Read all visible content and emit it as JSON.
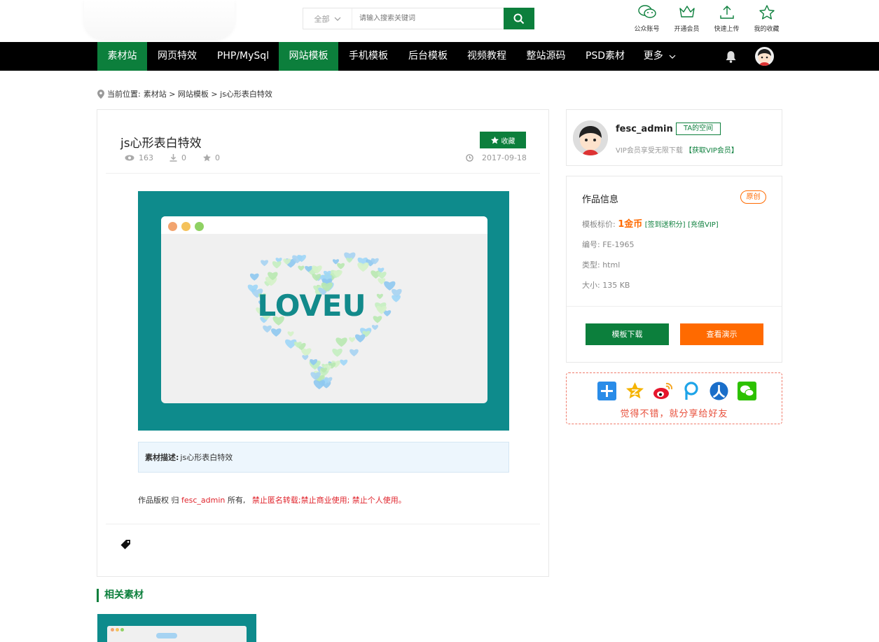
{
  "search": {
    "category": "全部",
    "placeholder": "请输入搜索关键词"
  },
  "tools": [
    {
      "label": "公众账号",
      "icon": "wechat-icon"
    },
    {
      "label": "开通会员",
      "icon": "crown-icon"
    },
    {
      "label": "快速上传",
      "icon": "upload-icon"
    },
    {
      "label": "我的收藏",
      "icon": "star-icon"
    }
  ],
  "nav": [
    "素材站",
    "网页特效",
    "PHP/MySql",
    "网站模板",
    "手机模板",
    "后台模板",
    "视频教程",
    "整站源码",
    "PSD素材",
    "更多"
  ],
  "breadcrumb": {
    "prefix": "当前位置:",
    "path": "素材站 > 网站模板 > js心形表白特效"
  },
  "article": {
    "title": "js心形表白特效",
    "fav_label": "收藏",
    "views": "163",
    "downloads": "0",
    "stars": "0",
    "date": "2017-09-18",
    "preview_text": "LOVEU",
    "desc_label": "素材描述:",
    "desc_text": "js心形表白特效",
    "copy_prefix": "作品版权 归",
    "copy_author": "fesc_admin",
    "copy_mid": "所有,",
    "copy_rules": "禁止匿名转载;禁止商业使用;  禁止个人使用。"
  },
  "author": {
    "name": "fesc_admin",
    "space_btn": "TA的空间",
    "vip_text": "VIP会员享受无限下载",
    "vip_link": "【获取VIP会员】"
  },
  "info": {
    "title": "作品信息",
    "badge": "原创",
    "price_label": "模板标价:",
    "price": "1金币",
    "link1": "[签到送积分]",
    "link2": "[充值VIP]",
    "code": "编号: FE-1965",
    "type": "类型: html",
    "size": "大小: 135 KB",
    "download_btn": "模板下载",
    "demo_btn": "查看演示"
  },
  "share": {
    "slogan": "觉得不错，就分享给好友"
  },
  "related": {
    "title": "相关素材"
  },
  "colors": {
    "brand": "#0c7f3c",
    "orange": "#ff6a00",
    "preview_bg": "#0e8b8c"
  }
}
